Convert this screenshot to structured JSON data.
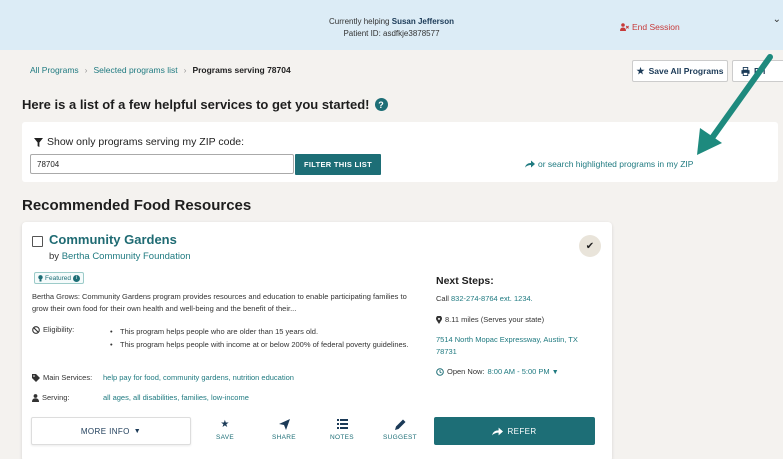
{
  "header": {
    "helping_prefix": "Currently helping",
    "client_name": "Susan Jefferson",
    "patient_id": "Patient ID: asdfkje3878577",
    "end_session_label": "End Session",
    "end_session_color": "#c73a3a"
  },
  "breadcrumb": {
    "items": [
      "All Programs",
      "Selected programs list",
      "Programs serving 78704"
    ]
  },
  "toolbar": {
    "save_all_label": "Save All Programs",
    "print_label": "Pri"
  },
  "intro": {
    "heading": "Here is a list of a few helpful services to get you started!"
  },
  "zip_filter": {
    "label": "Show only programs serving my ZIP code:",
    "input_value": "78704",
    "filter_button_label": "FILTER THIS LIST",
    "search_link_label": "or search highlighted programs in my ZIP"
  },
  "section": {
    "title": "Recommended Food Resources"
  },
  "program": {
    "name": "Community Gardens",
    "by_prefix": "by",
    "organization": "Bertha Community Foundation",
    "featured_label": "Featured",
    "description": "Bertha Grows: Community Gardens program provides resources and education to enable participating families to grow their own food for their own health and well-being and the benefit of their...",
    "eligibility_label": "Eligibility:",
    "eligibility": [
      "This program helps people who are older than 15 years old.",
      "This program helps people with income at or below 200% of federal poverty guidelines."
    ],
    "services_label": "Main Services:",
    "services": "help pay for food, community gardens, nutrition education",
    "serving_label": "Serving:",
    "serving": "all ages, all disabilities, families, low-income",
    "next_steps_title": "Next Steps:",
    "call_prefix": "Call",
    "phone": "832-274-8764 ext. 1234.",
    "distance": "8.11 miles (Serves your state)",
    "address": "7514 North Mopac Expressway, Austin, TX 78731",
    "open_label": "Open Now:",
    "hours": "8:00 AM - 5:00 PM"
  },
  "actions": {
    "more_info_label": "MORE INFO",
    "save_label": "SAVE",
    "share_label": "SHARE",
    "notes_label": "NOTES",
    "suggest_label": "SUGGEST",
    "refer_label": "REFER"
  },
  "colors": {
    "brand_teal": "#1d6e76",
    "header_bg": "#dcecf6",
    "annotation_arrow": "#1e8a7e"
  },
  "icons": [
    "user-x-icon",
    "star-icon",
    "printer-icon",
    "question-circle-icon",
    "filter-icon",
    "share-arrow-icon",
    "checkmark-icon",
    "lightbulb-icon",
    "info-icon",
    "ban-icon",
    "tag-icon",
    "user-icon",
    "map-pin-icon",
    "clock-icon",
    "chevron-down-icon",
    "paper-plane-icon",
    "list-icon",
    "pencil-icon"
  ]
}
